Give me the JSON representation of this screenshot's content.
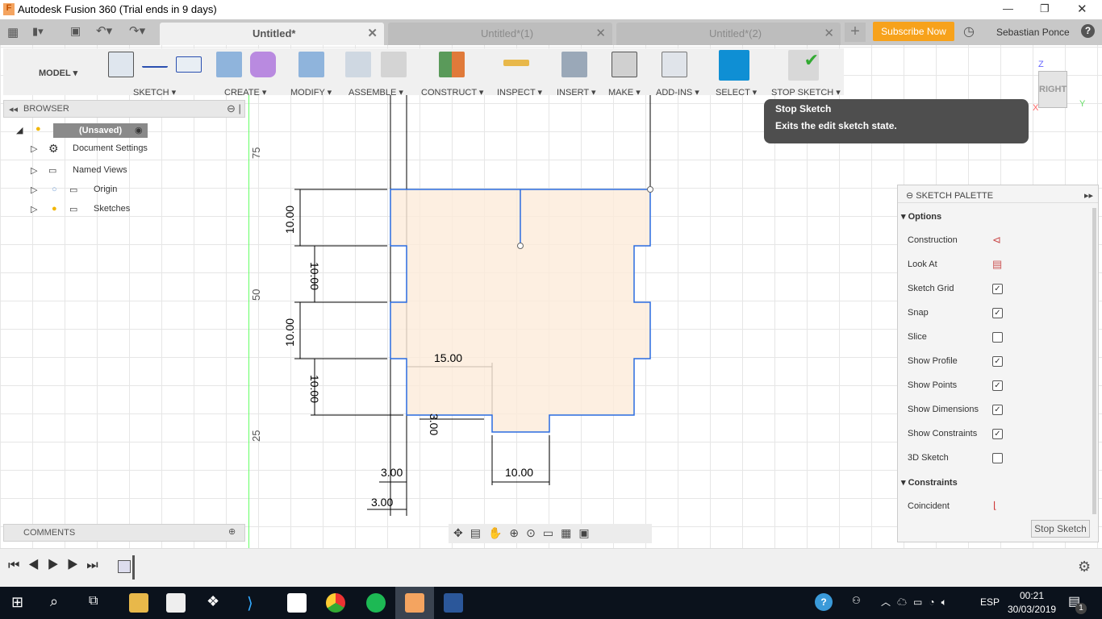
{
  "window": {
    "title": "Autodesk Fusion 360 (Trial ends in 9 days)",
    "minimize": "—",
    "maximize": "❐",
    "close": "✕"
  },
  "tabs": [
    {
      "label": "Untitled*",
      "active": true
    },
    {
      "label": "Untitled*(1)",
      "active": false
    },
    {
      "label": "Untitled*(2)",
      "active": false
    }
  ],
  "header": {
    "subscribe": "Subscribe Now",
    "user": "Sebastian Ponce",
    "help": "?",
    "new_tab": "+",
    "accent": "#f7a21b"
  },
  "toolbar": {
    "workspace": "MODEL ▾",
    "groups": [
      "SKETCH ▾",
      "CREATE ▾",
      "MODIFY ▾",
      "ASSEMBLE ▾",
      "CONSTRUCT ▾",
      "INSPECT ▾",
      "INSERT ▾",
      "MAKE ▾",
      "ADD-INS ▾",
      "SELECT ▾",
      "STOP SKETCH ▾"
    ]
  },
  "tooltip": {
    "title": "Stop Sketch",
    "text": "Exits the edit sketch state."
  },
  "browser": {
    "title": "BROWSER",
    "root": "(Unsaved)",
    "items": [
      "Document Settings",
      "Named Views",
      "Origin",
      "Sketches"
    ]
  },
  "comments": {
    "title": "COMMENTS"
  },
  "viewcube": {
    "face": "RIGHT",
    "z": "Z",
    "y": "Y",
    "x": "X"
  },
  "axis_labels": [
    "75",
    "50",
    "25"
  ],
  "dimensions": {
    "v1": "10.00",
    "v2": "10.00",
    "v3": "10.00",
    "v4": "10.00",
    "w15": "15.00",
    "w10": "10.00",
    "d3a": "3.00",
    "d3b": "3.00",
    "d3c": "3.00"
  },
  "palette": {
    "title": "SKETCH PALETTE",
    "options_title": "Options",
    "options": [
      {
        "label": "Construction",
        "type": "icon"
      },
      {
        "label": "Look At",
        "type": "icon"
      },
      {
        "label": "Sketch Grid",
        "checked": true
      },
      {
        "label": "Snap",
        "checked": true
      },
      {
        "label": "Slice",
        "checked": false
      },
      {
        "label": "Show Profile",
        "checked": true
      },
      {
        "label": "Show Points",
        "checked": true
      },
      {
        "label": "Show Dimensions",
        "checked": true
      },
      {
        "label": "Show Constraints",
        "checked": true
      },
      {
        "label": "3D Sketch",
        "checked": false
      }
    ],
    "constraints_title": "Constraints",
    "constraints": [
      "Coincident"
    ],
    "stop_button": "Stop Sketch"
  },
  "taskbar": {
    "lang": "ESP",
    "time": "00:21",
    "date": "30/03/2019",
    "notifications": "1"
  }
}
